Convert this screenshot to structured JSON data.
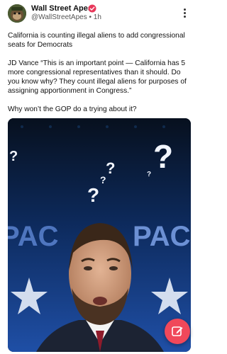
{
  "post": {
    "author": {
      "name": "Wall Street Apes",
      "handle": "@WallStreetApes",
      "separator": "•",
      "time": "1h",
      "avatar_icon": "ape-avatar-icon",
      "verified_icon": "verified-badge-icon",
      "verified_color": "#e8385a"
    },
    "more_icon": "more-vertical-icon",
    "paragraphs": [
      "California is counting illegal aliens to add congressional seats for Democrats",
      "JD Vance “This is an important point — California has 5 more congressional representatives than it should. Do you know why? They count illegal aliens for purposes of assigning apportionment in Congress.”",
      "Why won’t the GOP do a trying about it?"
    ],
    "media": {
      "kind": "video-still",
      "backdrop_text_left": "PAC",
      "backdrop_text_right": "PAC",
      "overlay_icon": "question-marks"
    }
  },
  "compose": {
    "icon": "compose-edit-icon",
    "color": "#f0485a"
  }
}
